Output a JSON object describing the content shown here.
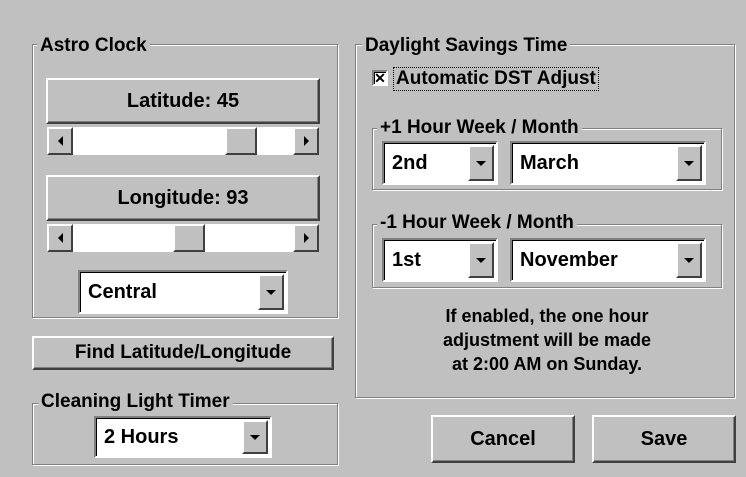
{
  "astro_clock": {
    "legend": "Astro Clock",
    "latitude_label": "Latitude: 45",
    "latitude_value": 45,
    "longitude_label": "Longitude: 93",
    "longitude_value": 93,
    "timezone": {
      "selected": "Central"
    }
  },
  "find_button": "Find Latitude/Longitude",
  "cleaning_timer": {
    "legend": "Cleaning Light Timer",
    "selected": "2 Hours"
  },
  "dst": {
    "legend": "Daylight Savings Time",
    "auto_checkbox": {
      "label": "Automatic DST Adjust",
      "checked": true,
      "mark": "✕"
    },
    "plus_hour": {
      "legend": "+1 Hour Week / Month",
      "week": "2nd",
      "month": "March"
    },
    "minus_hour": {
      "legend": "-1 Hour Week / Month",
      "week": "1st",
      "month": "November"
    },
    "info_lines": [
      "If enabled, the one hour",
      "adjustment will be made",
      "at 2:00 AM on Sunday."
    ]
  },
  "buttons": {
    "cancel": "Cancel",
    "save": "Save"
  },
  "colors": {
    "face": "#c0c0c0",
    "highlight": "#ffffff",
    "shadow": "#808080",
    "dark_shadow": "#404040"
  }
}
